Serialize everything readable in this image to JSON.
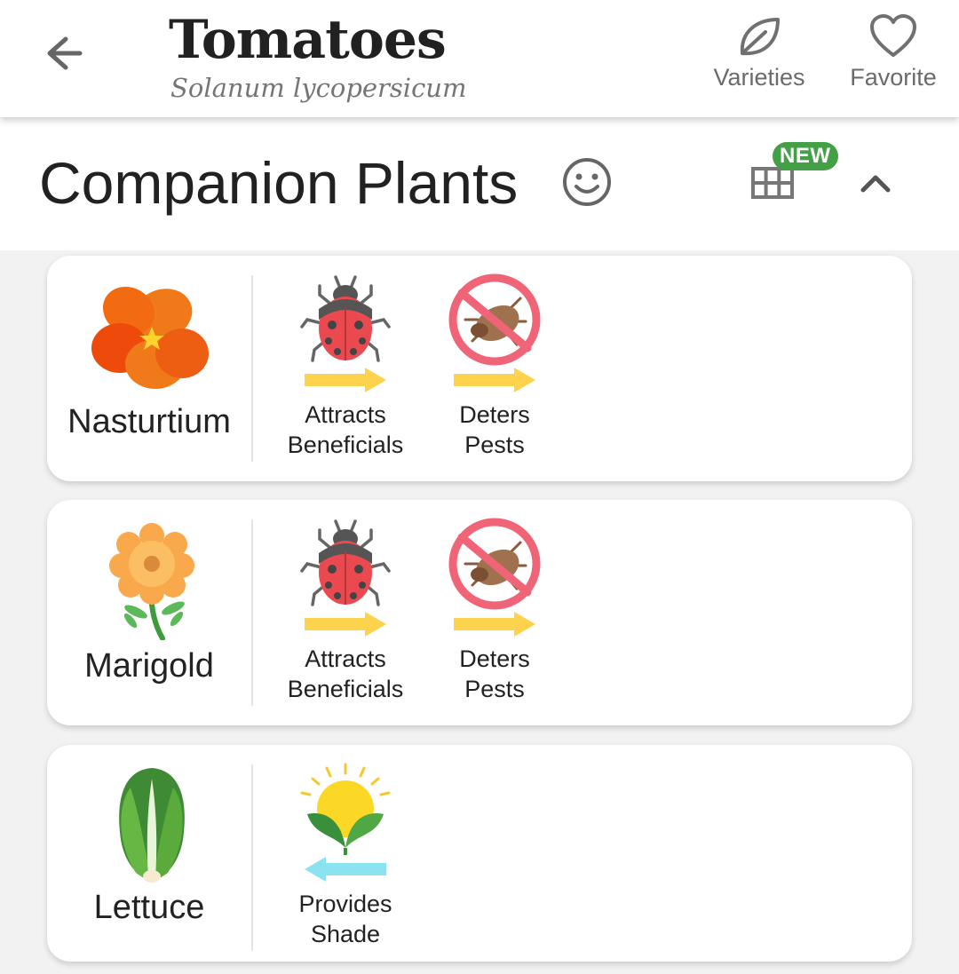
{
  "header": {
    "title": "Tomatoes",
    "subtitle": "Solanum lycopersicum",
    "actions": {
      "varieties": "Varieties",
      "favorite": "Favorite"
    }
  },
  "section": {
    "title": "Companion Plants",
    "badge": "NEW"
  },
  "companions": [
    {
      "name": "Nasturtium",
      "icon": "nasturtium-flower-icon",
      "benefits": [
        {
          "label": "Attracts\nBeneficials",
          "icon": "ladybug-icon",
          "direction": "right"
        },
        {
          "label": "Deters\nPests",
          "icon": "no-pest-icon",
          "direction": "right"
        }
      ]
    },
    {
      "name": "Marigold",
      "icon": "marigold-flower-icon",
      "benefits": [
        {
          "label": "Attracts\nBeneficials",
          "icon": "ladybug-icon",
          "direction": "right"
        },
        {
          "label": "Deters\nPests",
          "icon": "no-pest-icon",
          "direction": "right"
        }
      ]
    },
    {
      "name": "Lettuce",
      "icon": "lettuce-icon",
      "benefits": [
        {
          "label": "Provides\nShade",
          "icon": "sun-leaves-icon",
          "direction": "left"
        }
      ]
    }
  ],
  "colors": {
    "badge_green": "#43a047",
    "arrow_yellow": "#fdd34e",
    "arrow_blue": "#8be2f0",
    "ladybug_red": "#ea4a4f",
    "ban_pink": "#f06478"
  }
}
